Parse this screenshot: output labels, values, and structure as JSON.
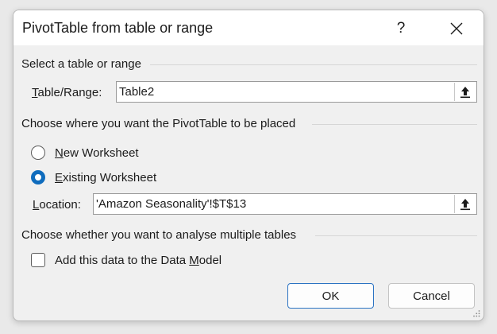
{
  "window": {
    "title": "PivotTable from table or range",
    "help_label": "?"
  },
  "section_source": {
    "heading": "Select a table or range",
    "field_label_accel": "T",
    "field_label_rest": "able/Range:",
    "value": "Table2"
  },
  "section_destination": {
    "heading": "Choose where you want the PivotTable to be placed",
    "options": [
      {
        "accel": "N",
        "rest": "ew Worksheet",
        "checked": false
      },
      {
        "accel": "E",
        "rest": "xisting Worksheet",
        "checked": true
      }
    ],
    "location_label_accel": "L",
    "location_label_rest": "ocation:",
    "location_value": "'Amazon Seasonality'!$T$13"
  },
  "section_multiple": {
    "heading": "Choose whether you want to analyse multiple tables",
    "checkbox_label_pre": "Add this data to the Data ",
    "checkbox_label_accel": "M",
    "checkbox_label_post": "odel",
    "checked": false
  },
  "buttons": {
    "ok_label": "OK",
    "cancel_label": "Cancel"
  },
  "colors": {
    "accent": "#0f6cbd",
    "dialog_bg": "#f0f0f0"
  }
}
